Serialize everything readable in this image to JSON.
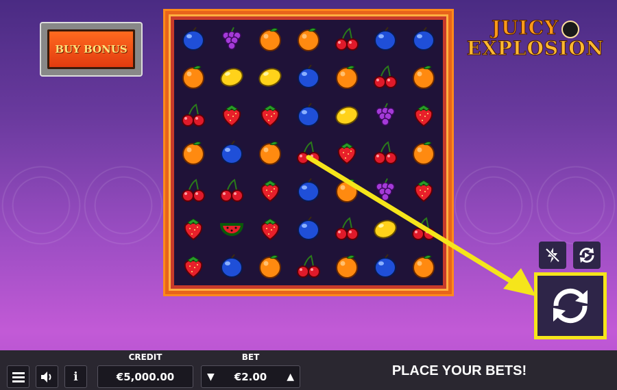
{
  "buy_bonus": {
    "label": "BUY BONUS"
  },
  "logo": {
    "line1": "JUICY",
    "line2": "EXPLOSION"
  },
  "grid": [
    [
      "plum",
      "grapes",
      "orange",
      "orange",
      "cherry",
      "plum",
      "plum"
    ],
    [
      "orange",
      "lemon",
      "lemon",
      "plum",
      "orange",
      "cherry",
      "orange"
    ],
    [
      "cherry",
      "strawberry",
      "strawberry",
      "plum",
      "lemon",
      "grapes",
      "strawberry"
    ],
    [
      "orange",
      "plum",
      "orange",
      "cherry",
      "strawberry",
      "cherry",
      "orange"
    ],
    [
      "cherry",
      "cherry",
      "strawberry",
      "plum",
      "orange",
      "grapes",
      "strawberry"
    ],
    [
      "strawberry",
      "watermelon",
      "strawberry",
      "plum",
      "cherry",
      "lemon",
      "cherry"
    ],
    [
      "strawberry",
      "plum",
      "orange",
      "cherry",
      "orange",
      "plum",
      "orange"
    ]
  ],
  "side_buttons": {
    "turbo_icon": "lightning-off-icon",
    "autoplay_icon": "autoplay-icon",
    "spin_icon": "spin-icon"
  },
  "bottom_bar": {
    "menu_icon": "menu-icon",
    "sound_icon": "sound-icon",
    "info_icon": "info-icon",
    "credit_label": "CREDIT",
    "credit_value": "€5,000.00",
    "bet_label": "BET",
    "bet_value": "€2.00",
    "status": "PLACE YOUR BETS!"
  },
  "colors": {
    "highlight": "#f5e51b",
    "board_bg": "#1f1238",
    "frame_orange": "#ff8a1a"
  }
}
